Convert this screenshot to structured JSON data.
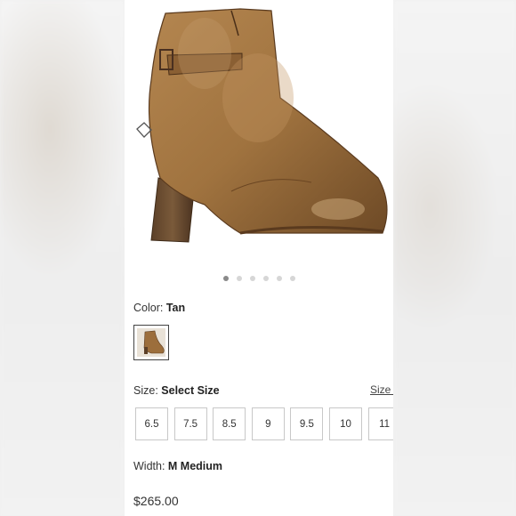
{
  "carousel": {
    "dot_count": 6,
    "active_index": 0
  },
  "color": {
    "label": "Color:",
    "value": "Tan",
    "swatch_icon": "tan-boot-thumbnail"
  },
  "size": {
    "label": "Size:",
    "value": "Select Size",
    "guide_link": "Size G",
    "options": [
      "6.5",
      "7.5",
      "8.5",
      "9",
      "9.5",
      "10",
      "11"
    ]
  },
  "width": {
    "label": "Width:",
    "value": "M Medium"
  },
  "price": "$265.00",
  "colors": {
    "leather": "#9c6e3c",
    "accent": "#333333"
  }
}
